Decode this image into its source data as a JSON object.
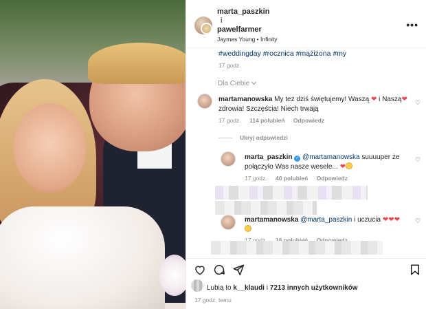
{
  "header": {
    "user1": "marta_paszkin",
    "connector": "i",
    "user2": "pawelfarmer",
    "music": "Jaymes Young • Infinity",
    "more_icon": "more-horizontal-icon"
  },
  "caption": {
    "tags": "#weddingday #rocznica #mążiżona #my",
    "time": "17 godz."
  },
  "sort": {
    "label": "Dla Ciebie"
  },
  "comments": [
    {
      "user": "martamanowska",
      "text": "My też dziś świętujemy! Waszą",
      "text2": "i Naszą",
      "text3": "zdrowia! Szczęścia! Niech trwają",
      "time": "17 godz.",
      "likes": "114 polubień",
      "reply": "Odpowiedz"
    }
  ],
  "hide_replies": "Ukryj odpowiedzi",
  "replies": [
    {
      "user": "marta_paszkin",
      "mention": "@martamanowska",
      "text": "suuuuper że",
      "text2": "połączyło Was nasze wesele...",
      "time": "17 godz.",
      "likes": "40 polubień",
      "reply": "Odpowiedz"
    },
    {
      "user": "martamanowska",
      "mention": "@marta_paszkin",
      "text": "i uczucia",
      "time": "17 godz.",
      "likes": "16 polubień",
      "reply": "Odpowiedz"
    }
  ],
  "likes_line": {
    "prefix": "Lubią to",
    "user": "k__klaudi",
    "middle": "i",
    "count": "7213 innych użytkowników"
  },
  "footer_time": "17 godz. temu",
  "colors": {
    "link": "#00376b",
    "muted": "#8e8e8e",
    "heart": "#ed4956"
  }
}
